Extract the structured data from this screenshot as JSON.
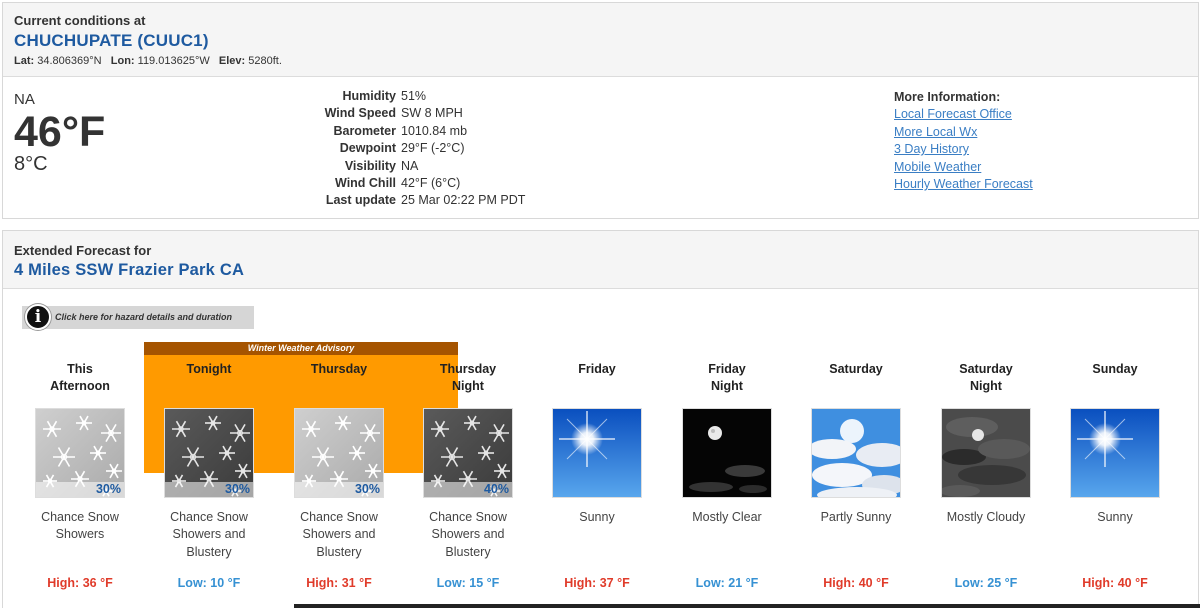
{
  "current": {
    "label": "Current conditions at",
    "station": "CHUCHUPATE (CUUC1)",
    "lat_label": "Lat:",
    "lat": "34.806369°N",
    "lon_label": "Lon:",
    "lon": "119.013625°W",
    "elev_label": "Elev:",
    "elev": "5280ft.",
    "condition": "NA",
    "temp_f": "46°F",
    "temp_c": "8°C",
    "details": [
      {
        "label": "Humidity",
        "value": "51%"
      },
      {
        "label": "Wind Speed",
        "value": "SW 8 MPH"
      },
      {
        "label": "Barometer",
        "value": "1010.84 mb"
      },
      {
        "label": "Dewpoint",
        "value": "29°F (-2°C)"
      },
      {
        "label": "Visibility",
        "value": "NA"
      },
      {
        "label": "Wind Chill",
        "value": "42°F (6°C)"
      },
      {
        "label": "Last update",
        "value": "25 Mar 02:22 PM PDT"
      }
    ],
    "more_info": {
      "title": "More Information:",
      "links": [
        "Local Forecast Office",
        "More Local Wx",
        "3 Day History",
        "Mobile Weather",
        "Hourly Weather Forecast"
      ]
    }
  },
  "forecast": {
    "label": "Extended Forecast for",
    "location": "4 Miles SSW Frazier Park CA",
    "hazard_button": "Click here for hazard details and duration",
    "advisory": "Winter Weather Advisory",
    "periods": [
      {
        "name_1": "This",
        "name_2": "Afternoon",
        "icon": "snow-showers-day-icon",
        "pop": "30%",
        "desc_1": "Chance Snow",
        "desc_2": "Showers",
        "desc_3": "",
        "temp": "High: 36 °F",
        "temp_kind": "high"
      },
      {
        "name_1": "Tonight",
        "name_2": "",
        "icon": "snow-showers-night-icon",
        "pop": "30%",
        "desc_1": "Chance Snow",
        "desc_2": "Showers and",
        "desc_3": "Blustery",
        "temp": "Low: 10 °F",
        "temp_kind": "low"
      },
      {
        "name_1": "Thursday",
        "name_2": "",
        "icon": "snow-showers-day-icon",
        "pop": "30%",
        "desc_1": "Chance Snow",
        "desc_2": "Showers and",
        "desc_3": "Blustery",
        "temp": "High: 31 °F",
        "temp_kind": "high"
      },
      {
        "name_1": "Thursday",
        "name_2": "Night",
        "icon": "snow-showers-night-icon",
        "pop": "40%",
        "desc_1": "Chance Snow",
        "desc_2": "Showers and",
        "desc_3": "Blustery",
        "temp": "Low: 15 °F",
        "temp_kind": "low"
      },
      {
        "name_1": "Friday",
        "name_2": "",
        "icon": "sunny-icon",
        "pop": "",
        "desc_1": "Sunny",
        "desc_2": "",
        "desc_3": "",
        "temp": "High: 37 °F",
        "temp_kind": "high"
      },
      {
        "name_1": "Friday",
        "name_2": "Night",
        "icon": "clear-night-icon",
        "pop": "",
        "desc_1": "Mostly Clear",
        "desc_2": "",
        "desc_3": "",
        "temp": "Low: 21 °F",
        "temp_kind": "low"
      },
      {
        "name_1": "Saturday",
        "name_2": "",
        "icon": "partly-sunny-icon",
        "pop": "",
        "desc_1": "Partly Sunny",
        "desc_2": "",
        "desc_3": "",
        "temp": "High: 40 °F",
        "temp_kind": "high"
      },
      {
        "name_1": "Saturday",
        "name_2": "Night",
        "icon": "mostly-cloudy-night-icon",
        "pop": "",
        "desc_1": "Mostly Cloudy",
        "desc_2": "",
        "desc_3": "",
        "temp": "Low: 25 °F",
        "temp_kind": "low"
      },
      {
        "name_1": "Sunday",
        "name_2": "",
        "icon": "sunny-icon",
        "pop": "",
        "desc_1": "Sunny",
        "desc_2": "",
        "desc_3": "",
        "temp": "High: 40 °F",
        "temp_kind": "high"
      }
    ]
  }
}
